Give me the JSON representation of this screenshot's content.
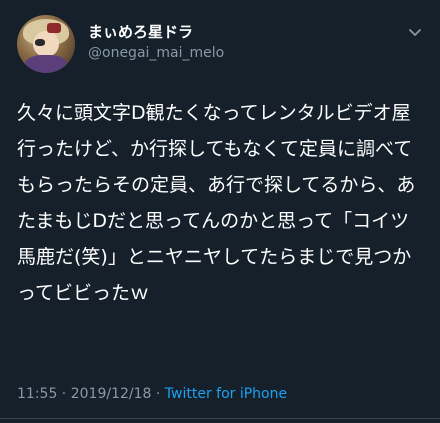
{
  "author": {
    "display_name": "まぃめろ星ドラ",
    "username": "@onegai_mai_melo"
  },
  "tweet": {
    "text": "久々に頭文字D観たくなってレンタルビデオ屋行ったけど、か行探してもなくて定員に調べてもらったらその定員、あ行で探してるから、あたまもじDだと思ってんのかと思って「コイツ馬鹿だ(笑)」とニヤニヤしてたらまじで見つかってビビったｗ"
  },
  "meta": {
    "time": "11:55",
    "separator1": " · ",
    "date": "2019/12/18",
    "separator2": " · ",
    "source": "Twitter for iPhone"
  },
  "icons": {
    "more": "chevron-down-icon"
  },
  "colors": {
    "background": "#15202b",
    "secondary_text": "#8899a6",
    "link": "#1da1f2"
  }
}
